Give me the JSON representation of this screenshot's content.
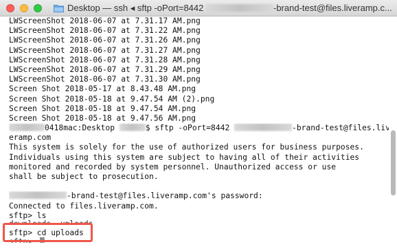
{
  "window": {
    "title_prefix": "Desktop — ssh ◂ sftp -oPort=8442 ",
    "title_suffix": "-brand-test@files.liveramp.c..."
  },
  "terminal": {
    "lines": [
      "LWScreenShot 2018-06-07 at 7.31.17 AM.png",
      "LWScreenShot 2018-06-07 at 7.31.22 AM.png",
      "LWScreenShot 2018-06-07 at 7.31.26 AM.png",
      "LWScreenShot 2018-06-07 at 7.31.27 AM.png",
      "LWScreenShot 2018-06-07 at 7.31.28 AM.png",
      "LWScreenShot 2018-06-07 at 7.31.29 AM.png",
      "LWScreenShot 2018-06-07 at 7.31.30 AM.png",
      "Screen Shot 2018-05-17 at 8.43.48 AM.png",
      "Screen Shot 2018-05-18 at 9.47.54 AM (2).png",
      "Screen Shot 2018-05-18 at 9.47.54 AM.png",
      "Screen Shot 2018-05-18 at 9.47.56 AM.png"
    ],
    "prompt_host": "0418mac:Desktop ",
    "prompt_cmd": "$ sftp -oPort=8442 ",
    "prompt_cmd_tail": "-brand-test@files.liv",
    "prompt_wrap": "eramp.com",
    "notice": [
      "This system is solely for the use of authorized users for business purposes.",
      "Individuals using this system are subject to having all of their activities",
      "monitored and recorded by system personnel. Unauthorized access or use",
      "shall be subject to prosecution."
    ],
    "password_prompt": "-brand-test@files.liveramp.com's password:",
    "connected": "Connected to files.liveramp.com.",
    "ls_cmd": "sftp> ls",
    "ls_output": "downloads  uploads",
    "cd_cmd": "sftp> cd uploads",
    "next_prompt": "sftp> "
  },
  "colors": {
    "highlight": "#f05547"
  }
}
